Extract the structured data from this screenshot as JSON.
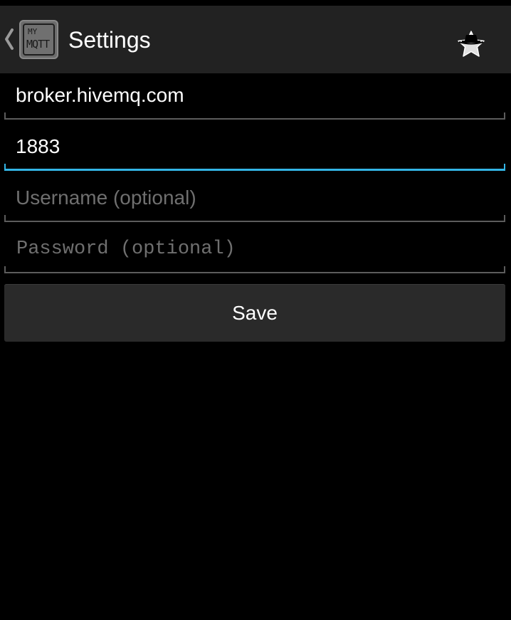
{
  "action_bar": {
    "title": "Settings",
    "logo": {
      "line1": "MY",
      "line2": "MQTT"
    },
    "up_icon": "chevron-left-icon",
    "action_icon": "star-hat-icon"
  },
  "form": {
    "broker": {
      "value": "broker.hivemq.com",
      "placeholder": ""
    },
    "port": {
      "value": "1883",
      "placeholder": ""
    },
    "username": {
      "value": "",
      "placeholder": "Username (optional)"
    },
    "password": {
      "value": "",
      "placeholder": "Password (optional)"
    },
    "save_label": "Save"
  },
  "colors": {
    "background": "#000000",
    "action_bar": "#222222",
    "focus_accent": "#33b5e5",
    "underline": "#5c5c5c",
    "button": "#2a2a2a"
  }
}
